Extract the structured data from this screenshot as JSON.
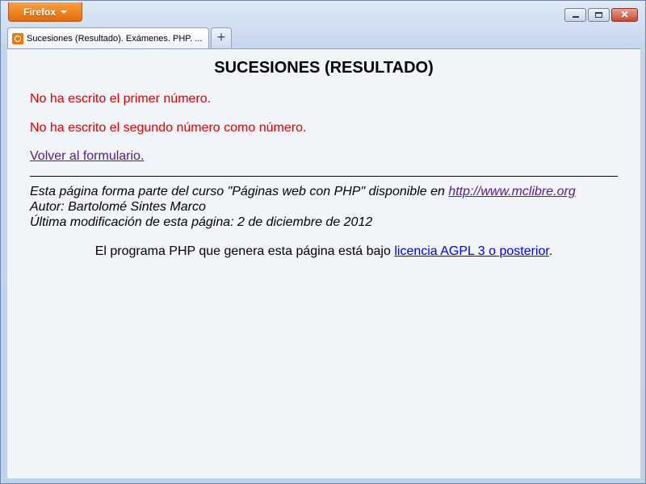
{
  "browser": {
    "menu_button": "Firefox",
    "tab_title": "Sucesiones (Resultado). Exámenes. PHP. ...",
    "new_tab": "+",
    "close_glyph": "✕"
  },
  "page": {
    "heading": "SUCESIONES (RESULTADO)",
    "error_first": "No ha escrito el primer número.",
    "error_second": "No ha escrito el segundo número como número.",
    "back_link": "Volver al formulario.",
    "footer": {
      "course_prefix": "Esta página forma parte del curso \"Páginas web con PHP\" disponible en ",
      "course_url": "http://www.mclibre.org",
      "author": "Autor: Bartolomé Sintes Marco",
      "modified": "Última modificación de esta página: 2 de diciembre de 2012"
    },
    "license": {
      "prefix": "El programa PHP que genera esta página está bajo ",
      "link": "licencia AGPL 3 o posterior",
      "suffix": "."
    }
  },
  "colors": {
    "error": "#e00000",
    "visited_link": "#551a8b",
    "link": "#0000ee",
    "firefox_orange": "#e87a14"
  }
}
